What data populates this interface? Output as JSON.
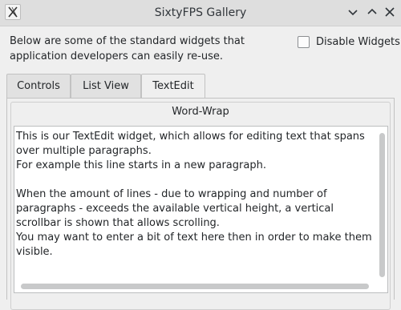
{
  "window": {
    "title": "SixtyFPS Gallery",
    "icon": "x-logo-icon",
    "controls": [
      "minimize-icon",
      "maximize-icon",
      "close-icon"
    ]
  },
  "header": {
    "description": "Below are some of the standard widgets that application developers can easily re-use.",
    "disable_widgets_label": "Disable Widgets",
    "disable_widgets_checked": false
  },
  "tabs": [
    {
      "label": "Controls",
      "active": false
    },
    {
      "label": "List View",
      "active": false
    },
    {
      "label": "TextEdit",
      "active": true
    }
  ],
  "textedit_page": {
    "group_title": "Word-Wrap",
    "text": "This is our TextEdit widget, which allows for editing text that spans over multiple paragraphs.\nFor example this line starts in a new paragraph.\n\nWhen the amount of lines - due to wrapping and number of paragraphs - exceeds the available vertical height, a vertical scrollbar is shown that allows scrolling.\nYou may want to enter a bit of text here then in order to make them visible."
  },
  "colors": {
    "window_bg": "#efefef",
    "titlebar_bg": "#dedede",
    "text": "#232629",
    "editor_bg": "#ffffff",
    "scroll_thumb": "#c8c9ca"
  }
}
